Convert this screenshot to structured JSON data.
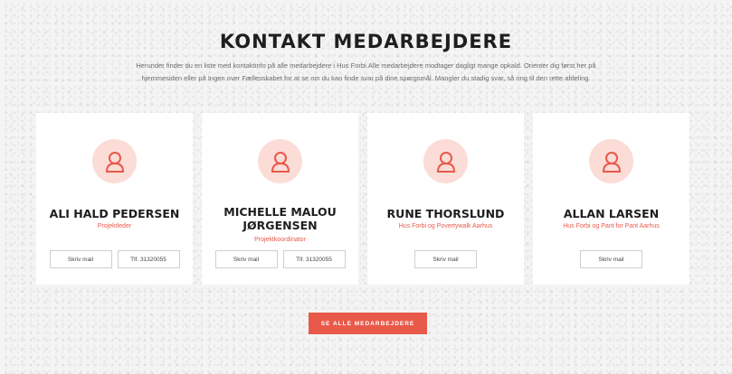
{
  "section": {
    "title": "Kontakt medarbejdere",
    "intro_line1": "Herunder finder du en liste med kontaktinfo på alle medarbejdere i Hus Forbi.Alle medarbejdere modtager dagligt mange opkald. Orienter dig først her på",
    "intro_line2": "hjemmesiden eller på Ingen over Fællesskabet for at se om du kan finde svar på dine spørgsmål. Mangler du stadig svar, så ring til den rette afdeling."
  },
  "colors": {
    "accent": "#e8594a",
    "avatar_bg": "#fbdcd6"
  },
  "icons": {
    "avatar": "user-icon"
  },
  "employees": [
    {
      "name_line1": "Ali Hald Pedersen",
      "name_line2": "",
      "role": "Projektleder",
      "mail_label": "Skriv mail",
      "phone_label": "Tlf. 31320055"
    },
    {
      "name_line1": "Michelle Malou",
      "name_line2": "Jørgensen",
      "role": "Projektkoordinator",
      "mail_label": "Skriv mail",
      "phone_label": "Tlf. 31320055"
    },
    {
      "name_line1": "Rune Thorslund",
      "name_line2": "",
      "role": "Hus Forbi og Povertywalk Aarhus",
      "mail_label": "Skriv mail",
      "phone_label": ""
    },
    {
      "name_line1": "Allan Larsen",
      "name_line2": "",
      "role": "Hus Forbi og Pant for Pant Aarhus",
      "mail_label": "Skriv mail",
      "phone_label": ""
    }
  ],
  "cta_label": "Se alle medarbejdere"
}
